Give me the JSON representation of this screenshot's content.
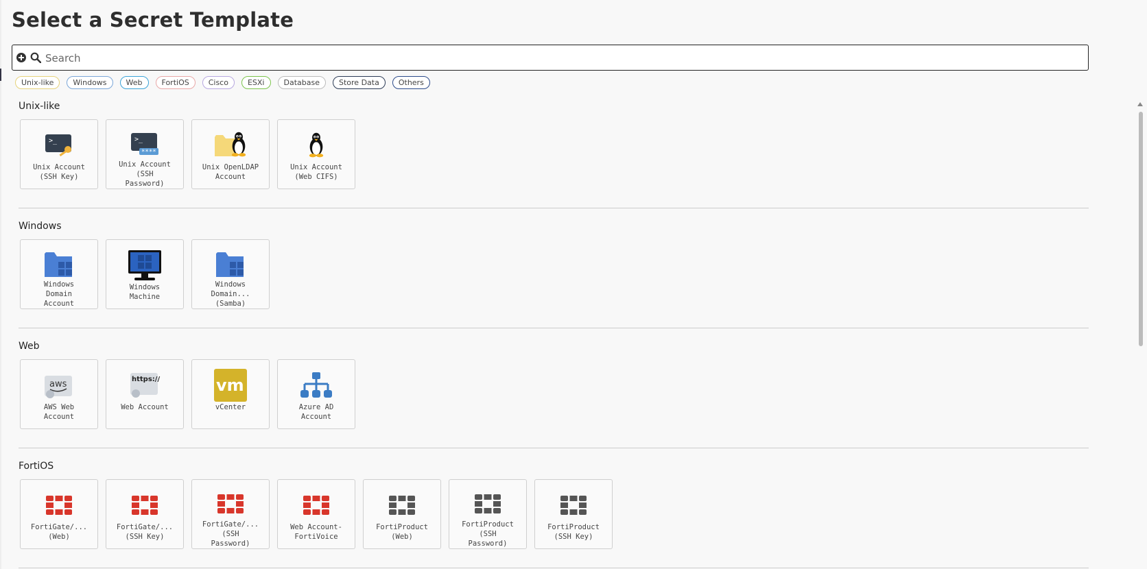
{
  "page": {
    "title": "Select a Secret Template",
    "search_placeholder": "Search"
  },
  "filters": [
    {
      "label": "Unix-like",
      "color": "#e6d27a"
    },
    {
      "label": "Windows",
      "color": "#7aa6d8"
    },
    {
      "label": "Web",
      "color": "#3aa3d8"
    },
    {
      "label": "FortiOS",
      "color": "#e8a7a7"
    },
    {
      "label": "Cisco",
      "color": "#b6a7e0"
    },
    {
      "label": "ESXi",
      "color": "#7bc44b"
    },
    {
      "label": "Database",
      "color": "#bbbbbb"
    },
    {
      "label": "Store Data",
      "color": "#2b3a55"
    },
    {
      "label": "Others",
      "color": "#2b4a8a"
    }
  ],
  "sections": [
    {
      "title": "Unix-like",
      "cards": [
        {
          "icon": "terminal-key-icon",
          "label": "Unix Account\n(SSH Key)"
        },
        {
          "icon": "terminal-password-icon",
          "label": "Unix Account\n(SSH\nPassword)"
        },
        {
          "icon": "folder-penguin-icon",
          "label": "Unix OpenLDAP\nAccount"
        },
        {
          "icon": "penguin-icon",
          "label": "Unix Account\n(Web CIFS)"
        }
      ]
    },
    {
      "title": "Windows",
      "cards": [
        {
          "icon": "windows-folder-icon",
          "label": "Windows\nDomain\nAccount"
        },
        {
          "icon": "windows-monitor-icon",
          "label": "Windows\nMachine"
        },
        {
          "icon": "windows-folder-icon",
          "label": "Windows\nDomain...\n(Samba)"
        }
      ]
    },
    {
      "title": "Web",
      "cards": [
        {
          "icon": "aws-icon",
          "label": "AWS Web\nAccount"
        },
        {
          "icon": "https-icon",
          "label": "Web Account"
        },
        {
          "icon": "vm-icon",
          "label": "vCenter"
        },
        {
          "icon": "network-tree-icon",
          "label": "Azure AD\nAccount"
        }
      ]
    },
    {
      "title": "FortiOS",
      "cards": [
        {
          "icon": "fortinet-red-icon",
          "label": "FortiGate/...\n(Web)"
        },
        {
          "icon": "fortinet-red-icon",
          "label": "FortiGate/...\n(SSH Key)"
        },
        {
          "icon": "fortinet-red-icon",
          "label": "FortiGate/...\n(SSH\nPassword)"
        },
        {
          "icon": "fortinet-red-icon",
          "label": "Web Account-\nFortiVoice"
        },
        {
          "icon": "fortinet-gray-icon",
          "label": "FortiProduct\n(Web)"
        },
        {
          "icon": "fortinet-gray-icon",
          "label": "FortiProduct\n(SSH\nPassword)"
        },
        {
          "icon": "fortinet-gray-icon",
          "label": "FortiProduct\n(SSH Key)"
        }
      ]
    }
  ],
  "icon_texts": {
    "terminal_prompt": ">_",
    "password_mask": "****",
    "aws": "aws",
    "https": "https://",
    "vm": "vm"
  },
  "colors": {
    "terminal": "#34404f",
    "windows_blue": "#4a7fd4",
    "fortinet_red": "#d8362b",
    "fortinet_gray": "#555555",
    "vm_gold": "#d4b32a",
    "azure_blue": "#3b7cc4"
  }
}
